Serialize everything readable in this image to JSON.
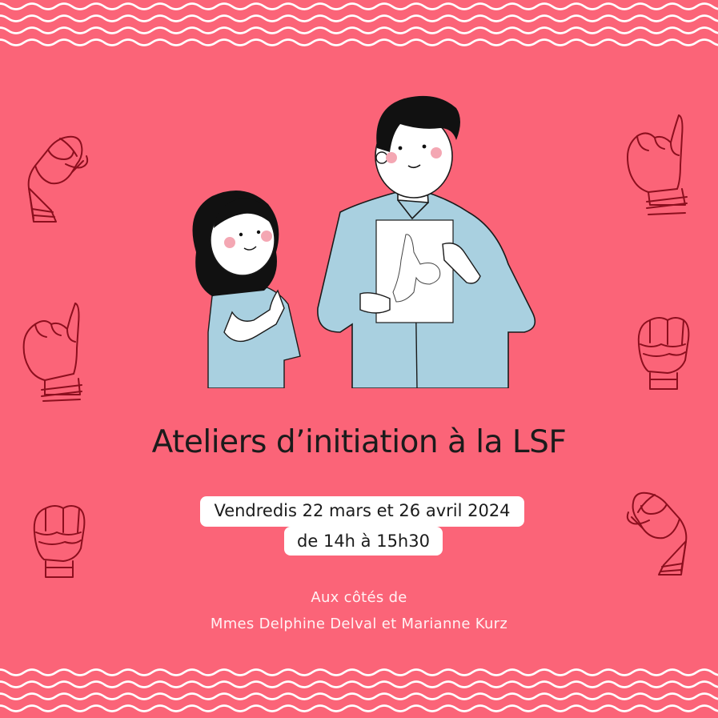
{
  "title": "Ateliers d’initiation à la LSF",
  "dates": {
    "line1": "Vendredis 22 mars et 26 avril 2024",
    "line2": "de 14h à 15h30"
  },
  "with": {
    "label": "Aux côtés de",
    "names": "Mmes Delphine Delval et Marianne Kurz"
  },
  "colors": {
    "background": "#fb6478",
    "wave": "#ffffff",
    "hand_outline": "#8c0f1e",
    "shirt": "#a9d0e0",
    "hair": "#111111"
  },
  "icons": [
    "hand-sign-icon",
    "wave-border-top",
    "wave-border-bottom",
    "teacher-and-girl-illustration"
  ]
}
